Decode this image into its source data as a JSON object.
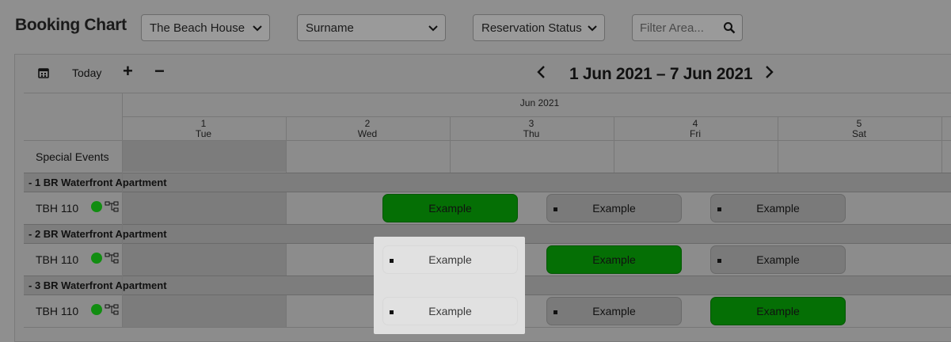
{
  "header": {
    "title": "Booking Chart",
    "property_select": "The Beach House",
    "sort_select": "Surname",
    "status_select": "Reservation Status",
    "filter_placeholder": "Filter Area..."
  },
  "toolbar": {
    "today_label": "Today",
    "zoom_in_label": "+",
    "zoom_out_label": "−",
    "date_range": "1 Jun 2021 – 7 Jun 2021"
  },
  "calendar": {
    "month": "Jun 2021",
    "days": [
      {
        "num": "1",
        "dow": "Tue"
      },
      {
        "num": "2",
        "dow": "Wed"
      },
      {
        "num": "3",
        "dow": "Thu"
      },
      {
        "num": "4",
        "dow": "Fri"
      },
      {
        "num": "5",
        "dow": "Sat"
      }
    ],
    "special_events_label": "Special Events"
  },
  "groups": [
    {
      "name": "-  1 BR Waterfront Apartment",
      "room": "TBH 110",
      "bookings": [
        {
          "label": "Example",
          "style": "green",
          "marker": false
        },
        {
          "label": "Example",
          "style": "gray",
          "marker": true
        },
        {
          "label": "Example",
          "style": "gray",
          "marker": true
        }
      ]
    },
    {
      "name": "-  2 BR Waterfront Apartment",
      "room": "TBH 110",
      "bookings": [
        {
          "label": "Example",
          "style": "light",
          "marker": true
        },
        {
          "label": "Example",
          "style": "green",
          "marker": false
        },
        {
          "label": "Example",
          "style": "gray",
          "marker": true
        }
      ]
    },
    {
      "name": "-  3 BR Waterfront Apartment",
      "room": "TBH 110",
      "bookings": [
        {
          "label": "Example",
          "style": "light",
          "marker": true
        },
        {
          "label": "Example",
          "style": "gray",
          "marker": true
        },
        {
          "label": "Example",
          "style": "green",
          "marker": false
        }
      ]
    }
  ],
  "colors": {
    "status_green": "#118d11",
    "booking_green": "#056f05",
    "overlay": "#8f8f8f",
    "highlight": "#e0e0e0"
  }
}
